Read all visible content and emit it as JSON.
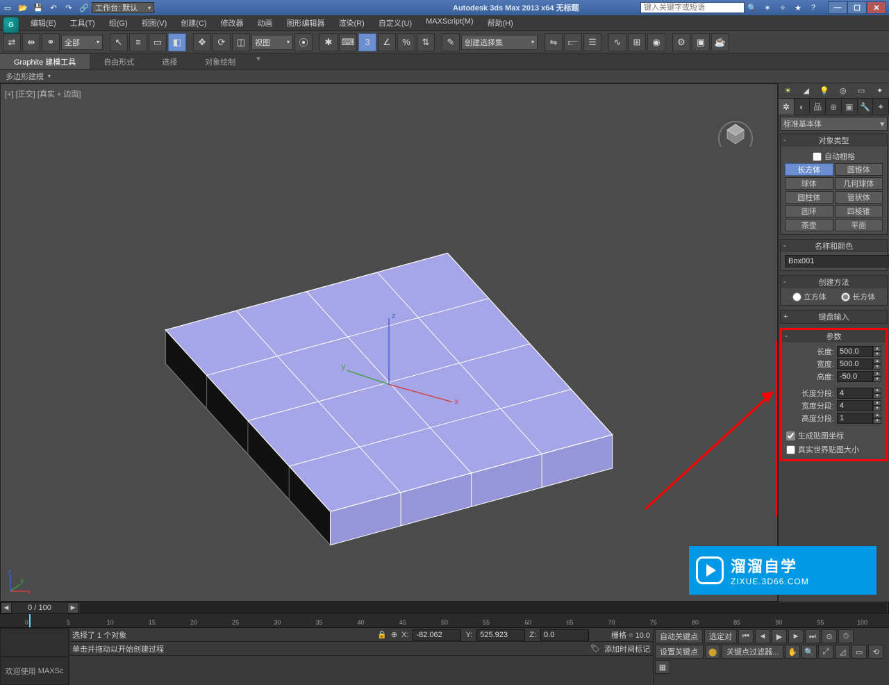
{
  "window": {
    "title": "Autodesk 3ds Max  2013 x64    无标题",
    "search_placeholder": "键入关键字或短语",
    "workspace_label": "工作台: 默认"
  },
  "menu": {
    "items": [
      "编辑(E)",
      "工具(T)",
      "组(G)",
      "视图(V)",
      "创建(C)",
      "修改器",
      "动画",
      "图形编辑器",
      "渲染(R)",
      "自定义(U)",
      "MAXScript(M)",
      "帮助(H)"
    ]
  },
  "maintoolbar": {
    "filter": "全部",
    "refcoord": "视图",
    "named_sel": "创建选择集"
  },
  "ribbon": {
    "tabs": [
      "Graphite 建模工具",
      "自由形式",
      "选择",
      "对象绘制"
    ],
    "strip": "多边形建模"
  },
  "viewport": {
    "label": "[+] [正交] [真实 + 边面]",
    "axis_x": "x",
    "axis_y": "y",
    "axis_z": "z"
  },
  "cmdpanel": {
    "category": "标准基本体",
    "rollout_objtype": "对象类型",
    "autogrid": "自动栅格",
    "primitives": [
      {
        "l": "长方体",
        "r": "圆锥体",
        "la": true
      },
      {
        "l": "球体",
        "r": "几何球体"
      },
      {
        "l": "圆柱体",
        "r": "管状体"
      },
      {
        "l": "圆环",
        "r": "四棱锥"
      },
      {
        "l": "茶壶",
        "r": "平面"
      }
    ],
    "rollout_namecolor": "名称和颜色",
    "obj_name": "Box001",
    "rollout_method": "创建方法",
    "method_cube": "立方体",
    "method_box": "长方体",
    "rollout_keyboard": "键盘输入",
    "rollout_params": "参数",
    "length_lbl": "长度:",
    "length_val": "500.0",
    "width_lbl": "宽度:",
    "width_val": "500.0",
    "height_lbl": "高度:",
    "height_val": "-50.0",
    "lsegs_lbl": "长度分段:",
    "lsegs_val": "4",
    "wsegs_lbl": "宽度分段:",
    "wsegs_val": "4",
    "hsegs_lbl": "高度分段:",
    "hsegs_val": "1",
    "genmap": "生成贴图坐标",
    "realworld": "真实世界贴图大小"
  },
  "timeline": {
    "range": "0 / 100",
    "ticks": [
      "0",
      "5",
      "10",
      "15",
      "20",
      "25",
      "30",
      "35",
      "40",
      "45",
      "50",
      "55",
      "60",
      "65",
      "70",
      "75",
      "80",
      "85",
      "90",
      "95",
      "100"
    ]
  },
  "status": {
    "selection": "选择了 1 个对象",
    "x_lbl": "X:",
    "x_val": "-82.062",
    "y_lbl": "Y:",
    "y_val": "525.923",
    "z_lbl": "Z:",
    "z_val": "0.0",
    "grid": "栅格 = 10.0",
    "autokey": "自动关键点",
    "selset": "选定对",
    "setkey": "设置关键点",
    "keyfilter": "关键点过滤器...",
    "prompt": "单击并拖动以开始创建过程",
    "addtime": "添加时间标记",
    "welcome": "欢迎使用",
    "maxscr": "MAXSc"
  },
  "watermark": {
    "line1": "溜溜自学",
    "line2": "ZIXUE.3D66.COM"
  }
}
